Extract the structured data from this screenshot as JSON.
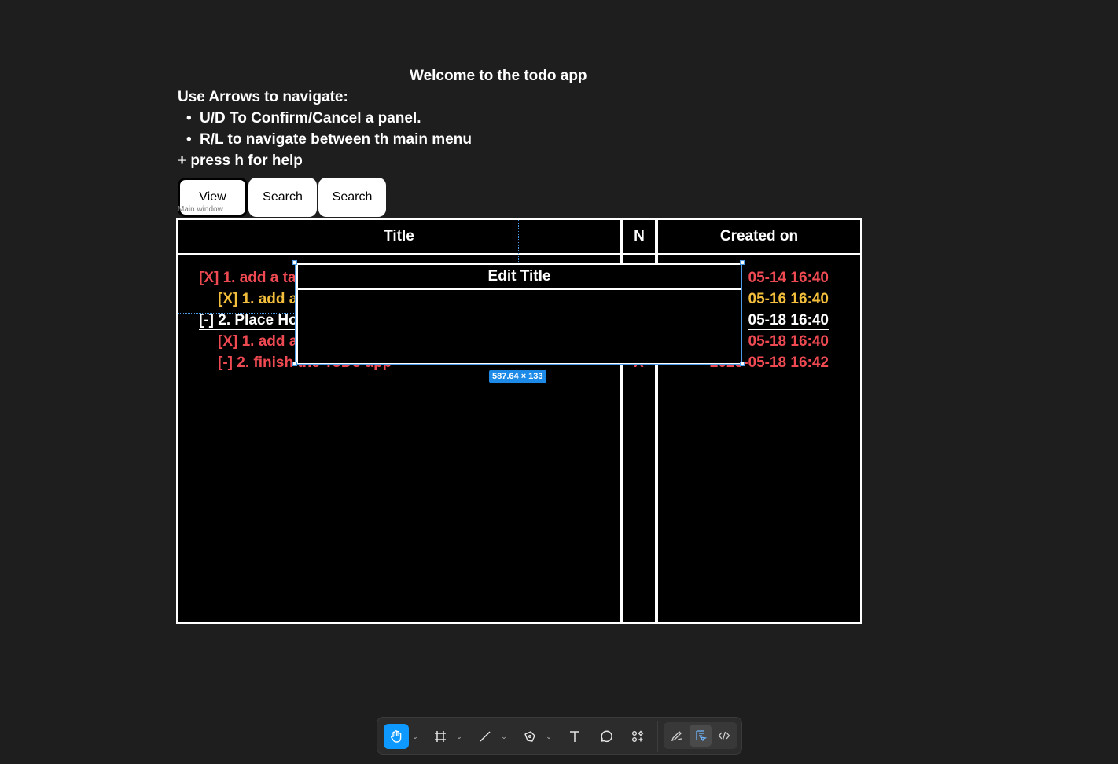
{
  "header": {
    "welcome": "Welcome to the todo app",
    "nav_heading": "Use Arrows to navigate:",
    "help_items": [
      "U/D To Confirm/Cancel a panel.",
      "R/L to navigate between th main menu"
    ],
    "press_h": "+ press h for help"
  },
  "tabs": [
    {
      "label": "View",
      "active": true
    },
    {
      "label": "Search"
    },
    {
      "label": "Search"
    }
  ],
  "frame_label": "Main window",
  "table": {
    "columns": [
      "Title",
      "N",
      "Created on"
    ],
    "rows": [
      {
        "title": "[X] 1. add a ta",
        "n": "",
        "created": "05-14  16:40",
        "color": "#ef4a52"
      },
      {
        "title": "[X] 1. add a",
        "n": "",
        "created": "05-16  16:40",
        "color": "#f2be3b"
      },
      {
        "title": "[-] 2. Place Ho",
        "n": "",
        "created": "05-18  16:40",
        "color": "#ffffff",
        "selected": true
      },
      {
        "title": "[X] 1. add a",
        "n": "",
        "created": "05-18  16:40",
        "color": "#ef4a52"
      },
      {
        "title": "[-]  2. finish the ToDo app",
        "n": "X",
        "created": "2023-05-18  16:42",
        "color": "#ef4a52"
      }
    ]
  },
  "dialog": {
    "title": "Edit Title",
    "value": "",
    "dimension_badge": "587.64 × 133"
  },
  "toolbar": {
    "tools": [
      "hand-tool",
      "frame-tool",
      "line-tool",
      "pen-tool",
      "text-tool",
      "comment-tool",
      "actions-tool"
    ],
    "modes": [
      "draw-mode",
      "design-mode",
      "dev-mode"
    ],
    "active_tool": "hand-tool",
    "active_mode": "design-mode",
    "accent": "#0d99ff"
  }
}
